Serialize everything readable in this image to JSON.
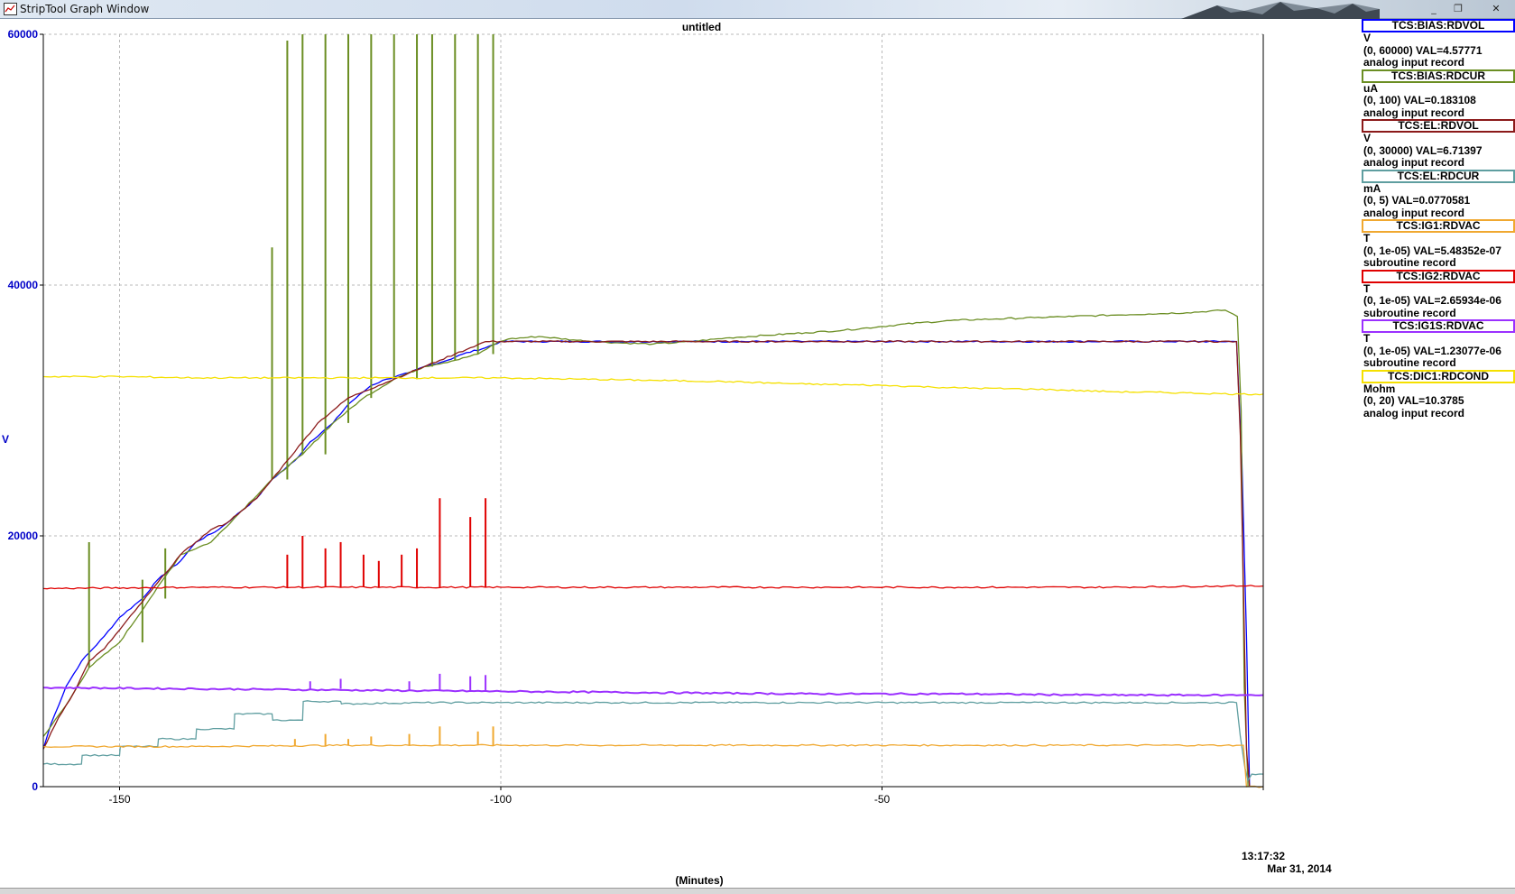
{
  "window": {
    "title": "StripTool Graph Window",
    "minimize": "_",
    "maximize": "❐",
    "close": "✕"
  },
  "graph": {
    "title": "untitled",
    "ylabel": "V",
    "xlabel": "(Minutes)",
    "time": "13:17:32",
    "date": "Mar 31, 2014"
  },
  "chart_data": {
    "type": "line",
    "xlabel": "(Minutes)",
    "ylabel": "V",
    "xlim": [
      -160,
      0
    ],
    "ylim": [
      0,
      60000
    ],
    "x_ticks": [
      "-150",
      "-100",
      "-50",
      "13:17:32"
    ],
    "y_ticks": [
      "0",
      "20000",
      "40000",
      "60000"
    ],
    "grid": true,
    "series": [
      {
        "name": "TCS:BIAS:RDVOL",
        "color": "#0000ff",
        "x": [
          -160,
          -159,
          -157,
          -155,
          -152,
          -150,
          -147,
          -145,
          -142,
          -140,
          -137,
          -135,
          -132,
          -130,
          -127,
          -125,
          -122,
          -120,
          -117,
          -115,
          -112,
          -110,
          -107,
          -105,
          -102,
          -100,
          -95,
          -90,
          -60,
          -30,
          -10,
          -3.5,
          -2.8,
          -2.2,
          -1.8
        ],
        "y": [
          3000,
          5000,
          8000,
          10000,
          12000,
          13500,
          15000,
          16500,
          18000,
          19500,
          20500,
          21500,
          23000,
          24500,
          26000,
          27500,
          29000,
          30500,
          32000,
          32500,
          33000,
          33500,
          34000,
          34500,
          35000,
          35500,
          35500,
          35500,
          35500,
          35500,
          35500,
          35500,
          26000,
          12000,
          0
        ]
      },
      {
        "name": "TCS:BIAS:RDCUR",
        "color": "#6b8e23",
        "x": [
          -160,
          -157,
          -154,
          -150,
          -146,
          -142,
          -138,
          -134,
          -130,
          -126,
          -122,
          -118,
          -114,
          -110,
          -106,
          -103,
          -100.2,
          -99,
          -95,
          -90,
          -85,
          -80,
          -75,
          -70,
          -65,
          -60,
          -55,
          -50,
          -45,
          -40,
          -35,
          -30,
          -25,
          -20,
          -15,
          -10,
          -5,
          -3.4,
          -2.9,
          -2.5,
          -2.0
        ],
        "y": [
          4000,
          6500,
          9500,
          11500,
          15000,
          18500,
          19500,
          22000,
          24500,
          26500,
          29000,
          31000,
          32500,
          33500,
          34000,
          34500,
          35500,
          35700,
          35900,
          35600,
          35400,
          35300,
          35500,
          35800,
          36000,
          36200,
          36400,
          36700,
          37000,
          37200,
          37300,
          37400,
          37500,
          37600,
          37700,
          37800,
          38000,
          37500,
          30000,
          8000,
          0
        ],
        "spikes": [
          [
            -154,
            19500
          ],
          [
            -147,
            16500
          ],
          [
            -144,
            19000
          ],
          [
            -130,
            43000
          ],
          [
            -128,
            59500
          ],
          [
            -126,
            60000
          ],
          [
            -123,
            60000
          ],
          [
            -120,
            60000
          ],
          [
            -117,
            60000
          ],
          [
            -114,
            60000
          ],
          [
            -111,
            60000
          ],
          [
            -109,
            60000
          ],
          [
            -106,
            60000
          ],
          [
            -103,
            60000
          ],
          [
            -101,
            60000
          ]
        ]
      },
      {
        "name": "TCS:EL:RDVOL",
        "color": "#8b1a1a",
        "x": [
          -160,
          -158,
          -156,
          -154,
          -152,
          -150,
          -148,
          -146,
          -144,
          -142,
          -140,
          -138,
          -136,
          -134,
          -132,
          -130,
          -128,
          -126,
          -124,
          -122,
          -120,
          -118,
          -116,
          -114,
          -112,
          -110,
          -108,
          -106,
          -104,
          -102,
          -100,
          -60,
          -20,
          -3.5,
          -3.0,
          -2.6,
          -2.2,
          -1.8
        ],
        "y": [
          3000,
          5500,
          7500,
          10000,
          11000,
          12500,
          14000,
          15500,
          17000,
          18500,
          19500,
          20500,
          21000,
          22000,
          23000,
          24500,
          26000,
          27500,
          29000,
          30000,
          31000,
          31500,
          32000,
          32500,
          33000,
          33500,
          34000,
          34500,
          35000,
          35500,
          35500,
          35500,
          35500,
          35500,
          28000,
          16000,
          3000,
          0
        ]
      },
      {
        "name": "TCS:EL:RDCUR",
        "color": "#5f9ea0",
        "x": [
          -160,
          -155,
          -154.9,
          -150,
          -149.9,
          -145,
          -144.9,
          -140,
          -139.9,
          -135,
          -134.9,
          -130,
          -129.9,
          -126,
          -125.9,
          -121,
          -120.9,
          -110,
          -100,
          -60,
          -20,
          -3.5,
          -3.0,
          -2.4,
          -2.0,
          -1.5,
          0
        ],
        "y": [
          1800,
          1800,
          2500,
          2500,
          3200,
          3200,
          3800,
          3800,
          4600,
          4600,
          5800,
          5800,
          5300,
          5300,
          6800,
          6800,
          6600,
          6700,
          6700,
          6700,
          6700,
          6700,
          4000,
          1500,
          500,
          1000,
          1000
        ]
      },
      {
        "name": "TCS:IG1:RDVAC",
        "color": "#f0a830",
        "x": [
          -160,
          -140,
          -120,
          -100,
          -80,
          -60,
          -40,
          -20,
          -5,
          -3,
          -2.6,
          -2.2,
          0
        ],
        "y": [
          3200,
          3200,
          3300,
          3300,
          3300,
          3300,
          3300,
          3300,
          3300,
          3300,
          3300,
          0,
          0
        ],
        "spikes": [
          [
            -127,
            3800
          ],
          [
            -123,
            4200
          ],
          [
            -120,
            3800
          ],
          [
            -117,
            4000
          ],
          [
            -112,
            4200
          ],
          [
            -108,
            4800
          ],
          [
            -103,
            4400
          ],
          [
            -101,
            4800
          ]
        ]
      },
      {
        "name": "TCS:IG2:RDVAC",
        "color": "#e00000",
        "x": [
          -160,
          -140,
          -120,
          -100,
          -80,
          -60,
          -40,
          -20,
          -5,
          -3,
          -2.6,
          -2.2,
          0
        ],
        "y": [
          15800,
          15900,
          15900,
          15900,
          15900,
          15900,
          15900,
          15900,
          16000,
          16000,
          16000,
          16000,
          16000
        ],
        "spikes": [
          [
            -128,
            18500
          ],
          [
            -126,
            20000
          ],
          [
            -123,
            19000
          ],
          [
            -121,
            19500
          ],
          [
            -118,
            18500
          ],
          [
            -116,
            18000
          ],
          [
            -113,
            18500
          ],
          [
            -111,
            19000
          ],
          [
            -108,
            23000
          ],
          [
            -104,
            21500
          ],
          [
            -102,
            23000
          ]
        ]
      },
      {
        "name": "TCS:IG1S:RDVAC",
        "color": "#9b30ff",
        "x": [
          -160,
          -140,
          -120,
          -100,
          -80,
          -60,
          -40,
          -20,
          -5,
          -3,
          -2.6,
          -2.2,
          0
        ],
        "y": [
          7900,
          7800,
          7700,
          7600,
          7500,
          7400,
          7400,
          7300,
          7300,
          7300,
          7300,
          7300,
          7300
        ],
        "spikes": [
          [
            -125,
            8400
          ],
          [
            -121,
            8600
          ],
          [
            -112,
            8400
          ],
          [
            -108,
            9000
          ],
          [
            -104,
            8800
          ],
          [
            -102,
            8900
          ]
        ]
      },
      {
        "name": "TCS:DIC1:RDCOND",
        "color": "#f5e000",
        "x": [
          -160,
          -150,
          -140,
          -130,
          -120,
          -110,
          -100,
          -90,
          -80,
          -70,
          -60,
          -50,
          -40,
          -30,
          -20,
          -10,
          -3,
          0
        ],
        "y": [
          32700,
          32700,
          32600,
          32600,
          32600,
          32600,
          32600,
          32500,
          32400,
          32300,
          32100,
          32000,
          31800,
          31700,
          31500,
          31400,
          31300,
          31300
        ]
      }
    ]
  },
  "legend": [
    {
      "name": "TCS:BIAS:RDVOL",
      "unit": "V",
      "range": "(0, 60000) VAL=4.57771",
      "type": "analog input record",
      "color": "#0000ff"
    },
    {
      "name": "TCS:BIAS:RDCUR",
      "unit": "uA",
      "range": "(0, 100) VAL=0.183108",
      "type": "analog input record",
      "color": "#6b8e23"
    },
    {
      "name": "TCS:EL:RDVOL",
      "unit": "V",
      "range": "(0, 30000) VAL=6.71397",
      "type": "analog input record",
      "color": "#8b1a1a"
    },
    {
      "name": "TCS:EL:RDCUR",
      "unit": "mA",
      "range": "(0, 5) VAL=0.0770581",
      "type": "analog input record",
      "color": "#5f9ea0"
    },
    {
      "name": "TCS:IG1:RDVAC",
      "unit": "T",
      "range": "(0, 1e-05) VAL=5.48352e-07",
      "type": "subroutine record",
      "color": "#f0a830"
    },
    {
      "name": "TCS:IG2:RDVAC",
      "unit": "T",
      "range": "(0, 1e-05) VAL=2.65934e-06",
      "type": "subroutine record",
      "color": "#e00000"
    },
    {
      "name": "TCS:IG1S:RDVAC",
      "unit": "T",
      "range": "(0, 1e-05) VAL=1.23077e-06",
      "type": "subroutine record",
      "color": "#9b30ff"
    },
    {
      "name": "TCS:DIC1:RDCOND",
      "unit": "Mohm",
      "range": "(0, 20) VAL=10.3785",
      "type": "analog input record",
      "color": "#f5e000"
    }
  ]
}
